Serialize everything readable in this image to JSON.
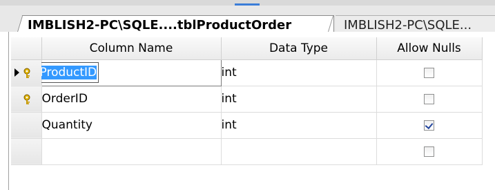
{
  "tabs": [
    {
      "label": "IMBLISH2-PC\\SQLE....tblProductOrder",
      "active": true
    },
    {
      "label": "IMBLISH2-PC\\SQLE...",
      "active": false
    }
  ],
  "columns": {
    "name": "Column Name",
    "type": "Data Type",
    "nulls": "Allow Nulls"
  },
  "rows": [
    {
      "name": "ProductID",
      "type": "int",
      "allow_nulls": false,
      "primary_key": true,
      "current": true
    },
    {
      "name": "OrderID",
      "type": "int",
      "allow_nulls": false,
      "primary_key": true,
      "current": false
    },
    {
      "name": "Quantity",
      "type": "int",
      "allow_nulls": true,
      "primary_key": false,
      "current": false
    },
    {
      "name": "",
      "type": "",
      "allow_nulls": false,
      "primary_key": false,
      "current": false
    }
  ],
  "colors": {
    "selection": "#3399ff",
    "key_icon": "#e0b400",
    "checkmark": "#23469d"
  }
}
